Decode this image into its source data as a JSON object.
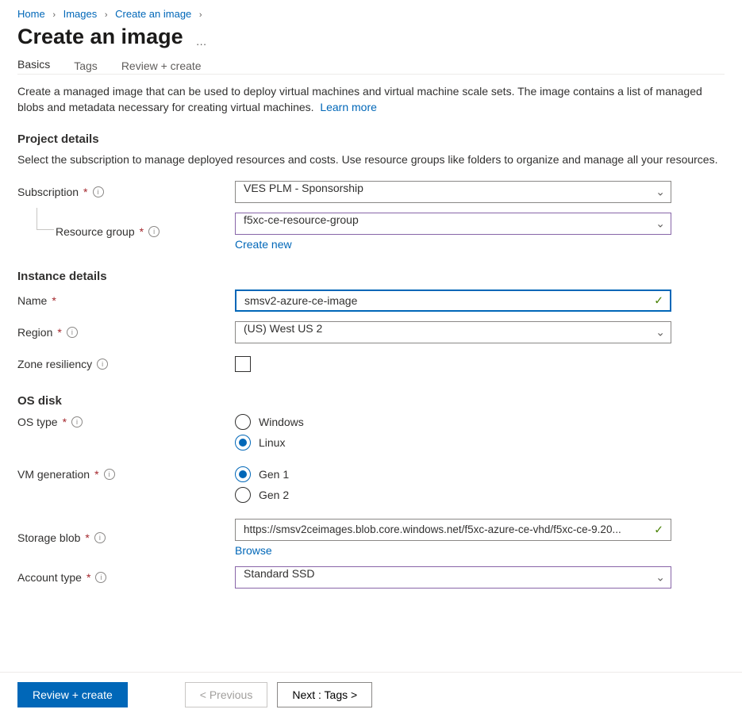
{
  "breadcrumb": {
    "items": [
      "Home",
      "Images",
      "Create an image"
    ]
  },
  "page": {
    "title": "Create an image"
  },
  "tabs": {
    "basics": "Basics",
    "tags": "Tags",
    "review": "Review + create"
  },
  "intro": {
    "text": "Create a managed image that can be used to deploy virtual machines and virtual machine scale sets. The image contains a list of managed blobs and metadata necessary for creating virtual machines.",
    "learn_more": "Learn more"
  },
  "project": {
    "header": "Project details",
    "sub": "Select the subscription to manage deployed resources and costs. Use resource groups like folders to organize and manage all your resources.",
    "subscription_label": "Subscription",
    "subscription_value": "VES PLM - Sponsorship",
    "rg_label": "Resource group",
    "rg_value": "f5xc-ce-resource-group",
    "create_new": "Create new"
  },
  "instance": {
    "header": "Instance details",
    "name_label": "Name",
    "name_value": "smsv2-azure-ce-image",
    "region_label": "Region",
    "region_value": "(US) West US 2",
    "zone_label": "Zone resiliency"
  },
  "osdisk": {
    "header": "OS disk",
    "ostype_label": "OS type",
    "ostype_windows": "Windows",
    "ostype_linux": "Linux",
    "vmgen_label": "VM generation",
    "vmgen_1": "Gen 1",
    "vmgen_2": "Gen 2",
    "storage_label": "Storage blob",
    "storage_value": "https://smsv2ceimages.blob.core.windows.net/f5xc-azure-ce-vhd/f5xc-ce-9.20...",
    "browse": "Browse",
    "account_label": "Account type",
    "account_value": "Standard SSD"
  },
  "footer": {
    "review": "Review + create",
    "prev": "< Previous",
    "next": "Next : Tags >"
  }
}
